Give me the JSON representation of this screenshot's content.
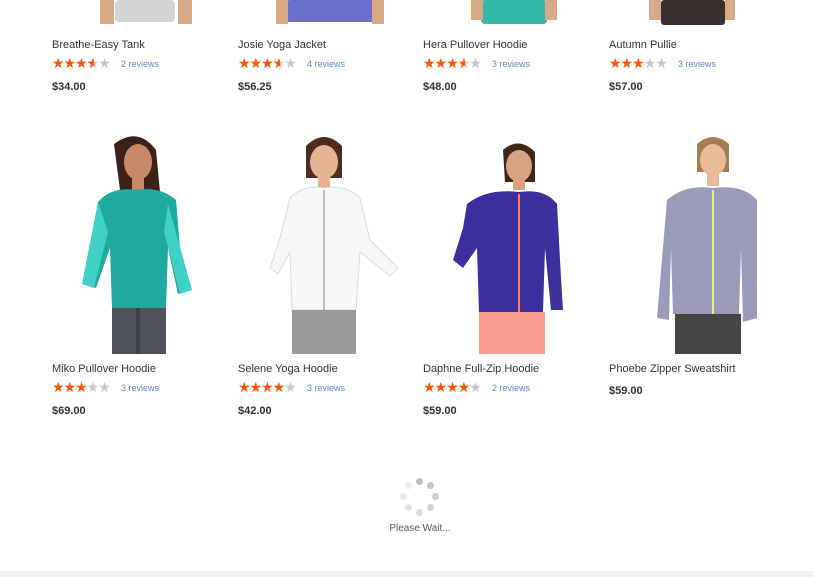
{
  "products": [
    {
      "name": "Breathe-Easy Tank",
      "rating_fraction": 0.7,
      "reviews": "2 reviews",
      "price": "$34.00"
    },
    {
      "name": "Josie Yoga Jacket",
      "rating_fraction": 0.7,
      "reviews": "4 reviews",
      "price": "$56.25"
    },
    {
      "name": "Hera Pullover Hoodie",
      "rating_fraction": 0.7,
      "reviews": "3 reviews",
      "price": "$48.00"
    },
    {
      "name": "Autumn Pullie",
      "rating_fraction": 0.6,
      "reviews": "3 reviews",
      "price": "$57.00"
    },
    {
      "name": "Miko Pullover Hoodie",
      "rating_fraction": 0.6,
      "reviews": "3 reviews",
      "price": "$69.00"
    },
    {
      "name": "Selene Yoga Hoodie",
      "rating_fraction": 0.8,
      "reviews": "3 reviews",
      "price": "$42.00"
    },
    {
      "name": "Daphne Full-Zip Hoodie",
      "rating_fraction": 0.8,
      "reviews": "2 reviews",
      "price": "$59.00"
    },
    {
      "name": "Phoebe Zipper Sweatshirt",
      "rating_fraction": null,
      "reviews": "",
      "price": "$59.00"
    }
  ],
  "loader": {
    "text": "Please Wait..."
  },
  "colors": {
    "star": "#ff5501",
    "star_empty": "#c7c7c7",
    "link": "#5b8ac6"
  },
  "icons": {
    "star": "star-icon",
    "spinner": "loading-spinner-icon"
  }
}
